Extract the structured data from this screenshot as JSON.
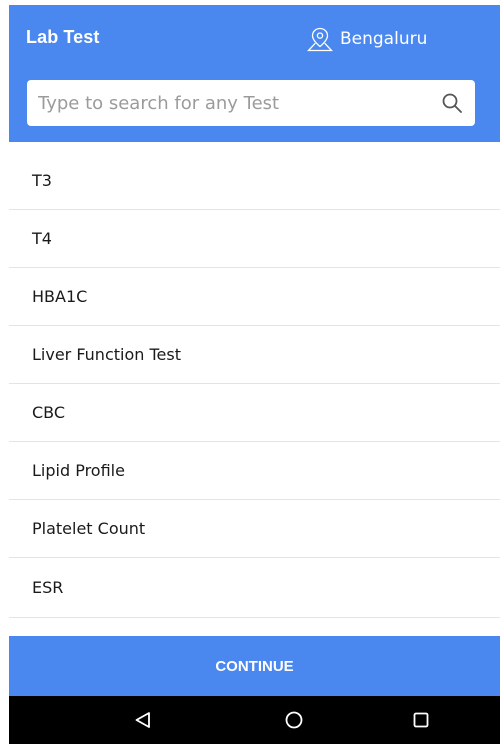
{
  "header": {
    "title": "Lab Test",
    "location": "Bengaluru",
    "location_icon": "location-pin-icon"
  },
  "search": {
    "placeholder": "Type to search for any Test",
    "value": "",
    "icon": "search-icon"
  },
  "tests": [
    {
      "label": "T3"
    },
    {
      "label": "T4"
    },
    {
      "label": "HBA1C"
    },
    {
      "label": "Liver Function Test"
    },
    {
      "label": "CBC"
    },
    {
      "label": "Lipid Profile"
    },
    {
      "label": "Platelet Count"
    },
    {
      "label": "ESR"
    }
  ],
  "footer": {
    "continue_label": "CONTINUE"
  },
  "nav": {
    "back_icon": "back-triangle-icon",
    "home_icon": "home-circle-icon",
    "recent_icon": "recent-apps-square-icon"
  },
  "colors": {
    "primary": "#4a87ef",
    "nav_bar": "#000000",
    "divider": "#e4e4e4"
  }
}
